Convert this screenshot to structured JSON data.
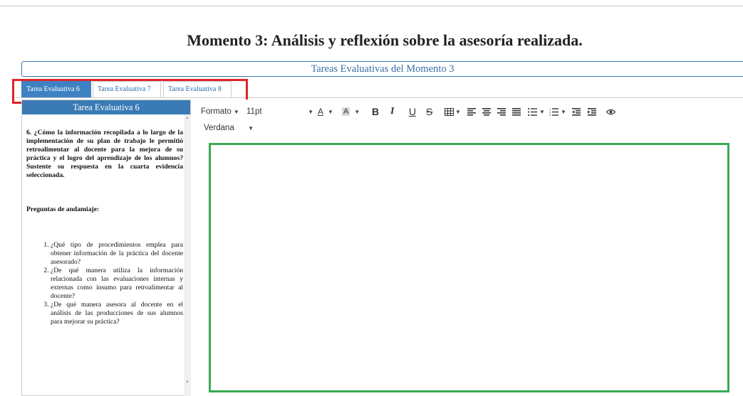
{
  "page_title": "Momento 3: Análisis y reflexión sobre la asesoría realizada.",
  "panel_header": "Tareas Evaluativas del Momento 3",
  "tabs": [
    {
      "label": "Tarea Evaluativa 6",
      "active": true
    },
    {
      "label": "Tarea Evaluativa 7",
      "active": false
    },
    {
      "label": "Tarea Evaluativa 8",
      "active": false
    }
  ],
  "left_panel": {
    "title": "Tarea Evaluativa 6",
    "question": "6. ¿Cómo la información recopilada a lo largo de la implementación de su plan de trabajo le permitió retroalimentar al docente para la mejora de su práctica y el logro del aprendizaje de los alumnos? Sustente su respuesta en la cuarta evidencia seleccionada.",
    "scaffold_heading": "Preguntas de andamiaje:",
    "scaffold_items": [
      "¿Qué tipo de procedimientos emplea para obtener información de la práctica del docente asesorado?",
      "¿De qué manera utiliza la información relacionada con las evaluaciones internas y externas como insumo para retroalimentar al docente?",
      "¿De qué manera asesora al docente en el análisis de las producciones de sus alumnos para mejorar su práctica?"
    ]
  },
  "toolbar": {
    "format_label": "Formato",
    "font_size": "11pt",
    "font_color_glyph": "A",
    "bg_color_glyph": "A",
    "bold_glyph": "B",
    "italic_glyph": "I",
    "underline_glyph": "U",
    "strike_glyph": "S",
    "font_family": "Verdana"
  },
  "colors": {
    "accent_blue": "#3a7ab5",
    "red_highlight": "#e0232a",
    "green_highlight": "#3aaa55"
  },
  "icons": [
    "table-icon",
    "align-left-icon",
    "align-center-icon",
    "align-right-icon",
    "align-justify-icon",
    "bullet-list-icon",
    "numbered-list-icon",
    "outdent-icon",
    "indent-icon",
    "eye-icon",
    "scroll-up-icon",
    "scroll-down-icon"
  ]
}
